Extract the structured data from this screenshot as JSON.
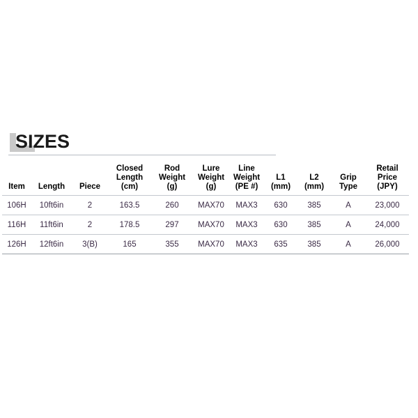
{
  "section": {
    "title": "SIZES",
    "accent_gray": "#c9c9c9",
    "rule_color": "#b6bcc2"
  },
  "table": {
    "columns": [
      {
        "key": "item",
        "label": "Item"
      },
      {
        "key": "length",
        "label": "Length"
      },
      {
        "key": "piece",
        "label": "Piece"
      },
      {
        "key": "closed_length",
        "label": "Closed\nLength\n(cm)",
        "line1": "Closed",
        "line2": "Length",
        "line3": "(cm)"
      },
      {
        "key": "rod_weight",
        "label": "Rod\nWeight\n(g)",
        "line1": "Rod",
        "line2": "Weight",
        "line3": "(g)"
      },
      {
        "key": "lure_weight",
        "label": "Lure\nWeight\n(g)",
        "line1": "Lure",
        "line2": "Weight",
        "line3": "(g)"
      },
      {
        "key": "line_weight",
        "label": "Line\nWeight\n(PE #)",
        "line1": "Line",
        "line2": "Weight",
        "line3": "(PE #)"
      },
      {
        "key": "l1",
        "label": "L1\n(mm)",
        "line1": "L1",
        "line2": "(mm)"
      },
      {
        "key": "l2",
        "label": "L2\n(mm)",
        "line1": "L2",
        "line2": "(mm)"
      },
      {
        "key": "grip_type",
        "label": "Grip\nType",
        "line1": "Grip",
        "line2": "Type"
      },
      {
        "key": "retail_price",
        "label": "Retail\nPrice\n(JPY)",
        "line1": "Retail",
        "line2": "Price",
        "line3": "(JPY)"
      }
    ],
    "rows": [
      {
        "item": "106H",
        "length": "10ft6in",
        "piece": "2",
        "closed_length": "163.5",
        "rod_weight": "260",
        "lure_weight": "MAX70",
        "line_weight": "MAX3",
        "l1": "630",
        "l2": "385",
        "grip_type": "A",
        "retail_price": "23,000"
      },
      {
        "item": "116H",
        "length": "11ft6in",
        "piece": "2",
        "closed_length": "178.5",
        "rod_weight": "297",
        "lure_weight": "MAX70",
        "line_weight": "MAX3",
        "l1": "630",
        "l2": "385",
        "grip_type": "A",
        "retail_price": "24,000"
      },
      {
        "item": "126H",
        "length": "12ft6in",
        "piece": "3(B)",
        "closed_length": "165",
        "rod_weight": "355",
        "lure_weight": "MAX70",
        "line_weight": "MAX3",
        "l1": "635",
        "l2": "385",
        "grip_type": "A",
        "retail_price": "26,000"
      }
    ],
    "accent_color": "#7b3f8f",
    "body_text_color": "#3b2b46",
    "header_text_color": "#000000",
    "border_color": "#c3c8ce"
  }
}
